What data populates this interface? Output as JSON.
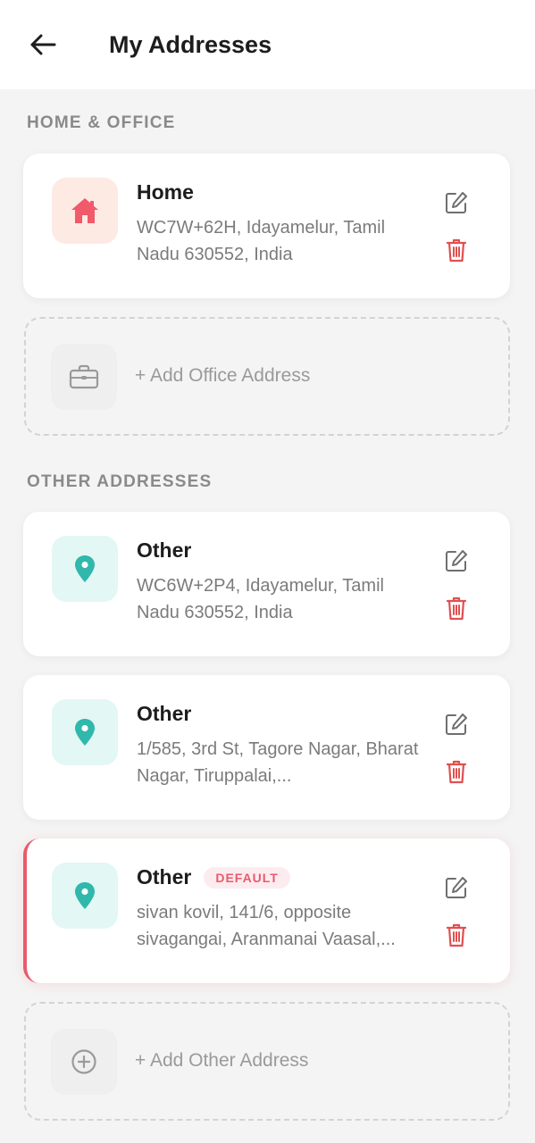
{
  "header": {
    "title": "My Addresses",
    "back_icon": "arrow-left-icon"
  },
  "sections": {
    "home_office_label": "HOME & OFFICE",
    "other_label": "OTHER ADDRESSES"
  },
  "home_office": {
    "home": {
      "title": "Home",
      "address": "WC7W+62H, Idayamelur, Tamil Nadu 630552, India",
      "icon": "home-icon"
    },
    "add_office_label": "+ Add Office Address"
  },
  "other_addresses": [
    {
      "title": "Other",
      "address": "WC6W+2P4, Idayamelur, Tamil Nadu 630552, India",
      "icon": "location-pin-icon"
    },
    {
      "title": "Other",
      "address": "1/585, 3rd St, Tagore Nagar, Bharat Nagar, Tiruppalai,...",
      "icon": "location-pin-icon"
    },
    {
      "title": "Other",
      "badge": "DEFAULT",
      "address": "sivan kovil, 141/6, opposite sivagangai, Aranmanai Vaasal,...",
      "icon": "location-pin-icon"
    }
  ],
  "add_other_label": "+ Add Other Address",
  "colors": {
    "accent": "#e95a6c",
    "home_icon": "#f05a6a",
    "pin_icon": "#2fb8ab",
    "delete_icon": "#e0504f",
    "background": "#f4f4f4"
  }
}
